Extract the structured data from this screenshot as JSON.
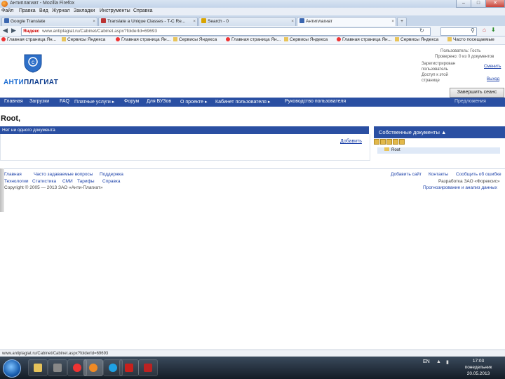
{
  "window": {
    "title": "Антиплагиат - Mozilla Firefox",
    "min": "–",
    "max": "□",
    "close": "✕"
  },
  "menu": [
    "Файл",
    "Правка",
    "Вид",
    "Журнал",
    "Закладки",
    "Инструменты",
    "Справка"
  ],
  "tabs": [
    {
      "label": "Google Translate"
    },
    {
      "label": "Translate a Unique Classes - T-C Re..."
    },
    {
      "label": "Search - 0"
    },
    {
      "label": "Антиплагиат"
    }
  ],
  "tab_new": "+",
  "address": {
    "brand": "Яндекс",
    "url": "www.antiplagiat.ru/Cabinet/Cabinet.aspx?folderId=69693"
  },
  "bookmarks": [
    {
      "label": "Главная страница Ян...",
      "icon": "yandex"
    },
    {
      "label": "Сервисы Яндекса",
      "icon": "folder"
    },
    {
      "label": "Главная страница Ян...",
      "icon": "yandex"
    },
    {
      "label": "Сервисы Яндекса",
      "icon": "folder"
    },
    {
      "label": "Главная страница Ян...",
      "icon": "yandex"
    },
    {
      "label": "Сервисы Яндекса",
      "icon": "folder"
    },
    {
      "label": "Главная страница Ян...",
      "icon": "yandex"
    },
    {
      "label": "Сервисы Яндекса",
      "icon": "folder"
    },
    {
      "label": "Часто посещаемые",
      "icon": "folder"
    }
  ],
  "logo": {
    "part1": "АНТИ",
    "part2": "ПЛАГИАТ"
  },
  "account": {
    "line1": "Пользователь: Гость",
    "line2": "Проверено: 0 из 0 документов",
    "registered_l1": "Зарегистрирован",
    "registered_l2": "пользователь",
    "registered_l3": "Доступ к этой",
    "registered_l4": "странице",
    "link_reg": "Сменить",
    "link_exit": "Выход",
    "complete_button": "Завершить сеанс"
  },
  "nav": [
    "Главная",
    "Загрузки",
    "FAQ",
    "Платные услуги ▸",
    "Форум",
    "Для ВУЗов",
    "О проекте ▸",
    "Кабинет пользователя ▸",
    "Руководство пользователя"
  ],
  "nav_right": "Предложения",
  "page_title": "Root,",
  "docs": {
    "header": "Нет ни одного документа",
    "add": "Добавить"
  },
  "own_docs": {
    "header": "Собственные документы ▲",
    "root": "Root"
  },
  "footer": {
    "row1_left": [
      "Главная",
      "Часто задаваемые вопросы",
      "Поддержка"
    ],
    "row1_right": [
      "Добавить сайт",
      "Контакты",
      "Сообщить об ошибке"
    ],
    "row2_left": [
      "Технологии",
      "Статистика",
      "СМИ",
      "Тарифы",
      "Справка"
    ],
    "row2_right": "Разработка ЗАО «Форексис»",
    "row3_left": "Copyright © 2005 — 2013 ЗАО «Анти-Плагиат»",
    "row3_right": "Прогнозирование и анализ данных"
  },
  "status": "www.antiplagiat.ru/Cabinet/Cabinet.aspx?folderId=69693",
  "tray": {
    "lang": "EN",
    "time": "17:03",
    "day": "понедельник",
    "date": "20.05.2013"
  },
  "colors": {
    "nav_blue": "#2a4fa2",
    "logo_blue": "#1e6ed3",
    "link": "#1a3fa8"
  }
}
